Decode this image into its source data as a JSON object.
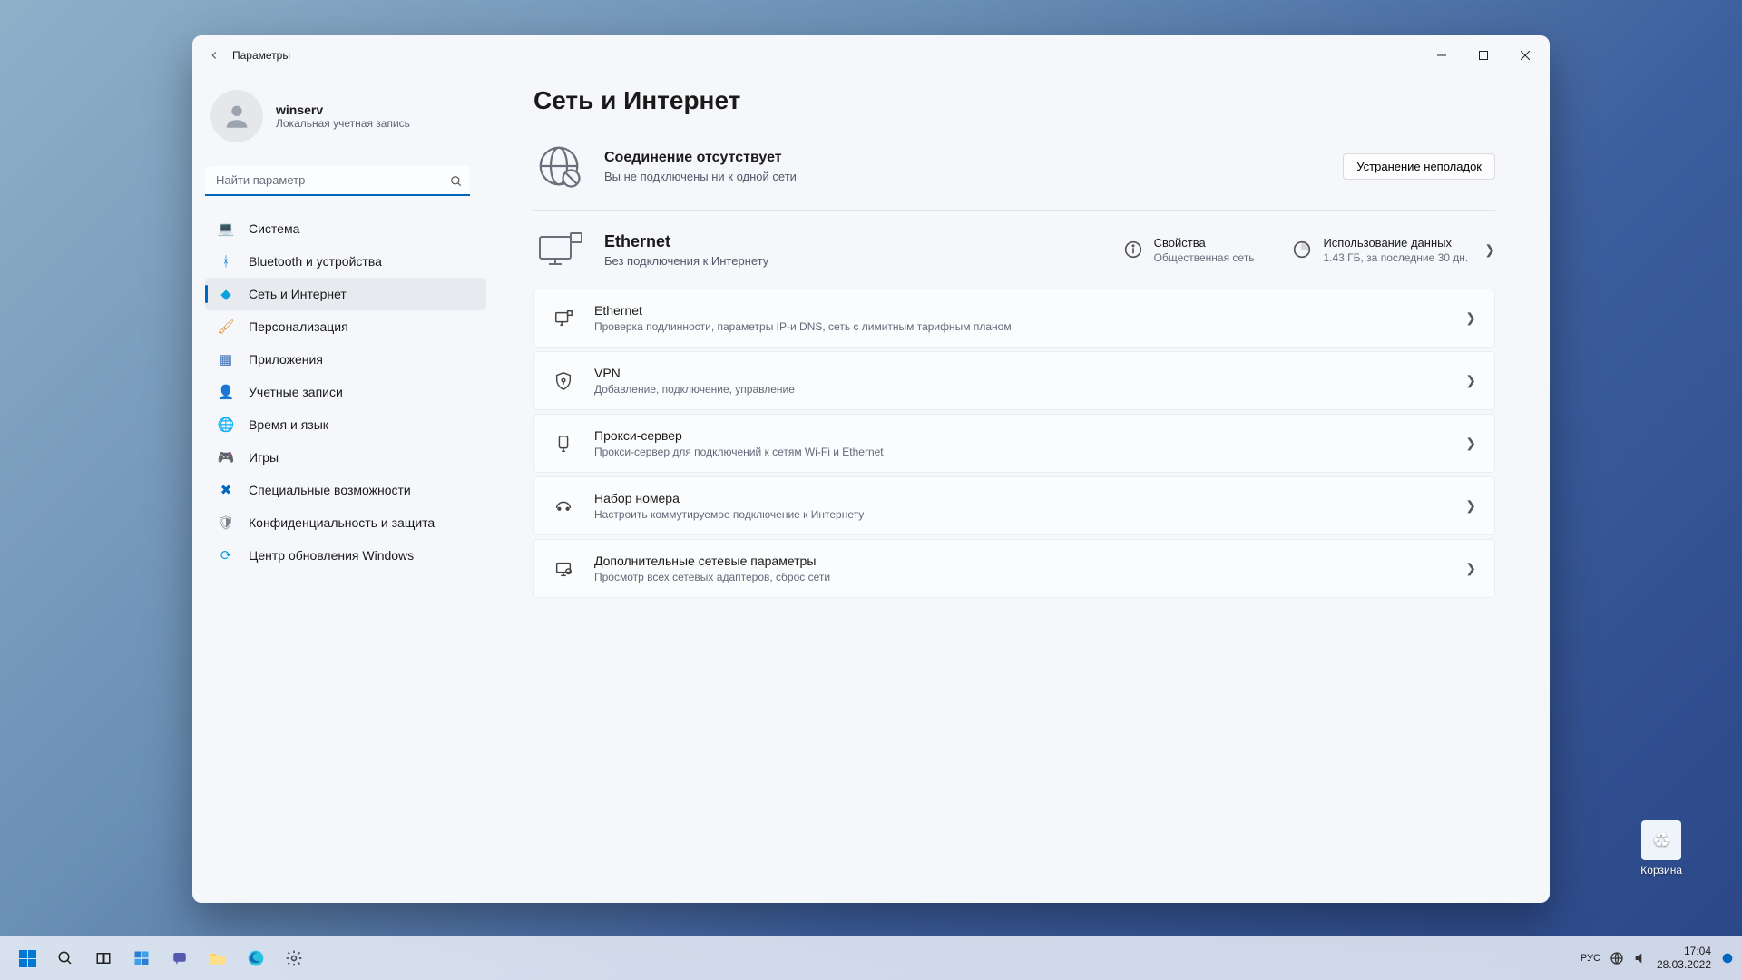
{
  "window": {
    "title": "Параметры"
  },
  "profile": {
    "username": "winserv",
    "subtitle": "Локальная учетная запись"
  },
  "search": {
    "placeholder": "Найти параметр"
  },
  "sidebar": {
    "items": [
      {
        "label": "Система",
        "icon": "💻",
        "color": "#0078d4"
      },
      {
        "label": "Bluetooth и устройства",
        "icon": "ᚼ",
        "color": "#0078d4"
      },
      {
        "label": "Сеть и Интернет",
        "icon": "◆",
        "color": "#0aa3e0",
        "active": true
      },
      {
        "label": "Персонализация",
        "icon": "🖌",
        "color": "#d38a2f"
      },
      {
        "label": "Приложения",
        "icon": "▦",
        "color": "#3b6fb6"
      },
      {
        "label": "Учетные записи",
        "icon": "👤",
        "color": "#2fb89a"
      },
      {
        "label": "Время и язык",
        "icon": "🌐",
        "color": "#4aa0cf"
      },
      {
        "label": "Игры",
        "icon": "🎮",
        "color": "#5c6570"
      },
      {
        "label": "Специальные возможности",
        "icon": "✖",
        "color": "#0067c0"
      },
      {
        "label": "Конфиденциальность и защита",
        "icon": "🛡",
        "color": "#7b7f88"
      },
      {
        "label": "Центр обновления Windows",
        "icon": "⟳",
        "color": "#0aa3e0"
      }
    ]
  },
  "page": {
    "title": "Сеть и Интернет",
    "status_title": "Соединение отсутствует",
    "status_sub": "Вы не подключены ни к одной сети",
    "troubleshoot_label": "Устранение неполадок",
    "ethernet": {
      "title": "Ethernet",
      "sub": "Без подключения к Интернету"
    },
    "properties": {
      "title": "Свойства",
      "sub": "Общественная сеть"
    },
    "datausage": {
      "title": "Использование данных",
      "sub": "1.43 ГБ, за последние 30 дн."
    },
    "settings": [
      {
        "title": "Ethernet",
        "sub": "Проверка подлинности, параметры IP-и DNS, сеть с лимитным тарифным планом",
        "icon": "ethernet"
      },
      {
        "title": "VPN",
        "sub": "Добавление, подключение, управление",
        "icon": "shield"
      },
      {
        "title": "Прокси-сервер",
        "sub": "Прокси-сервер для подключений к сетям Wi-Fi и Ethernet",
        "icon": "proxy"
      },
      {
        "title": "Набор номера",
        "sub": "Настроить коммутируемое подключение к Интернету",
        "icon": "dialup"
      },
      {
        "title": "Дополнительные сетевые параметры",
        "sub": "Просмотр всех сетевых адаптеров, сброс сети",
        "icon": "advanced"
      }
    ]
  },
  "desktop": {
    "recycle_label": "Корзина"
  },
  "taskbar": {
    "lang": "РУС",
    "time": "17:04",
    "date": "28.03.2022"
  }
}
